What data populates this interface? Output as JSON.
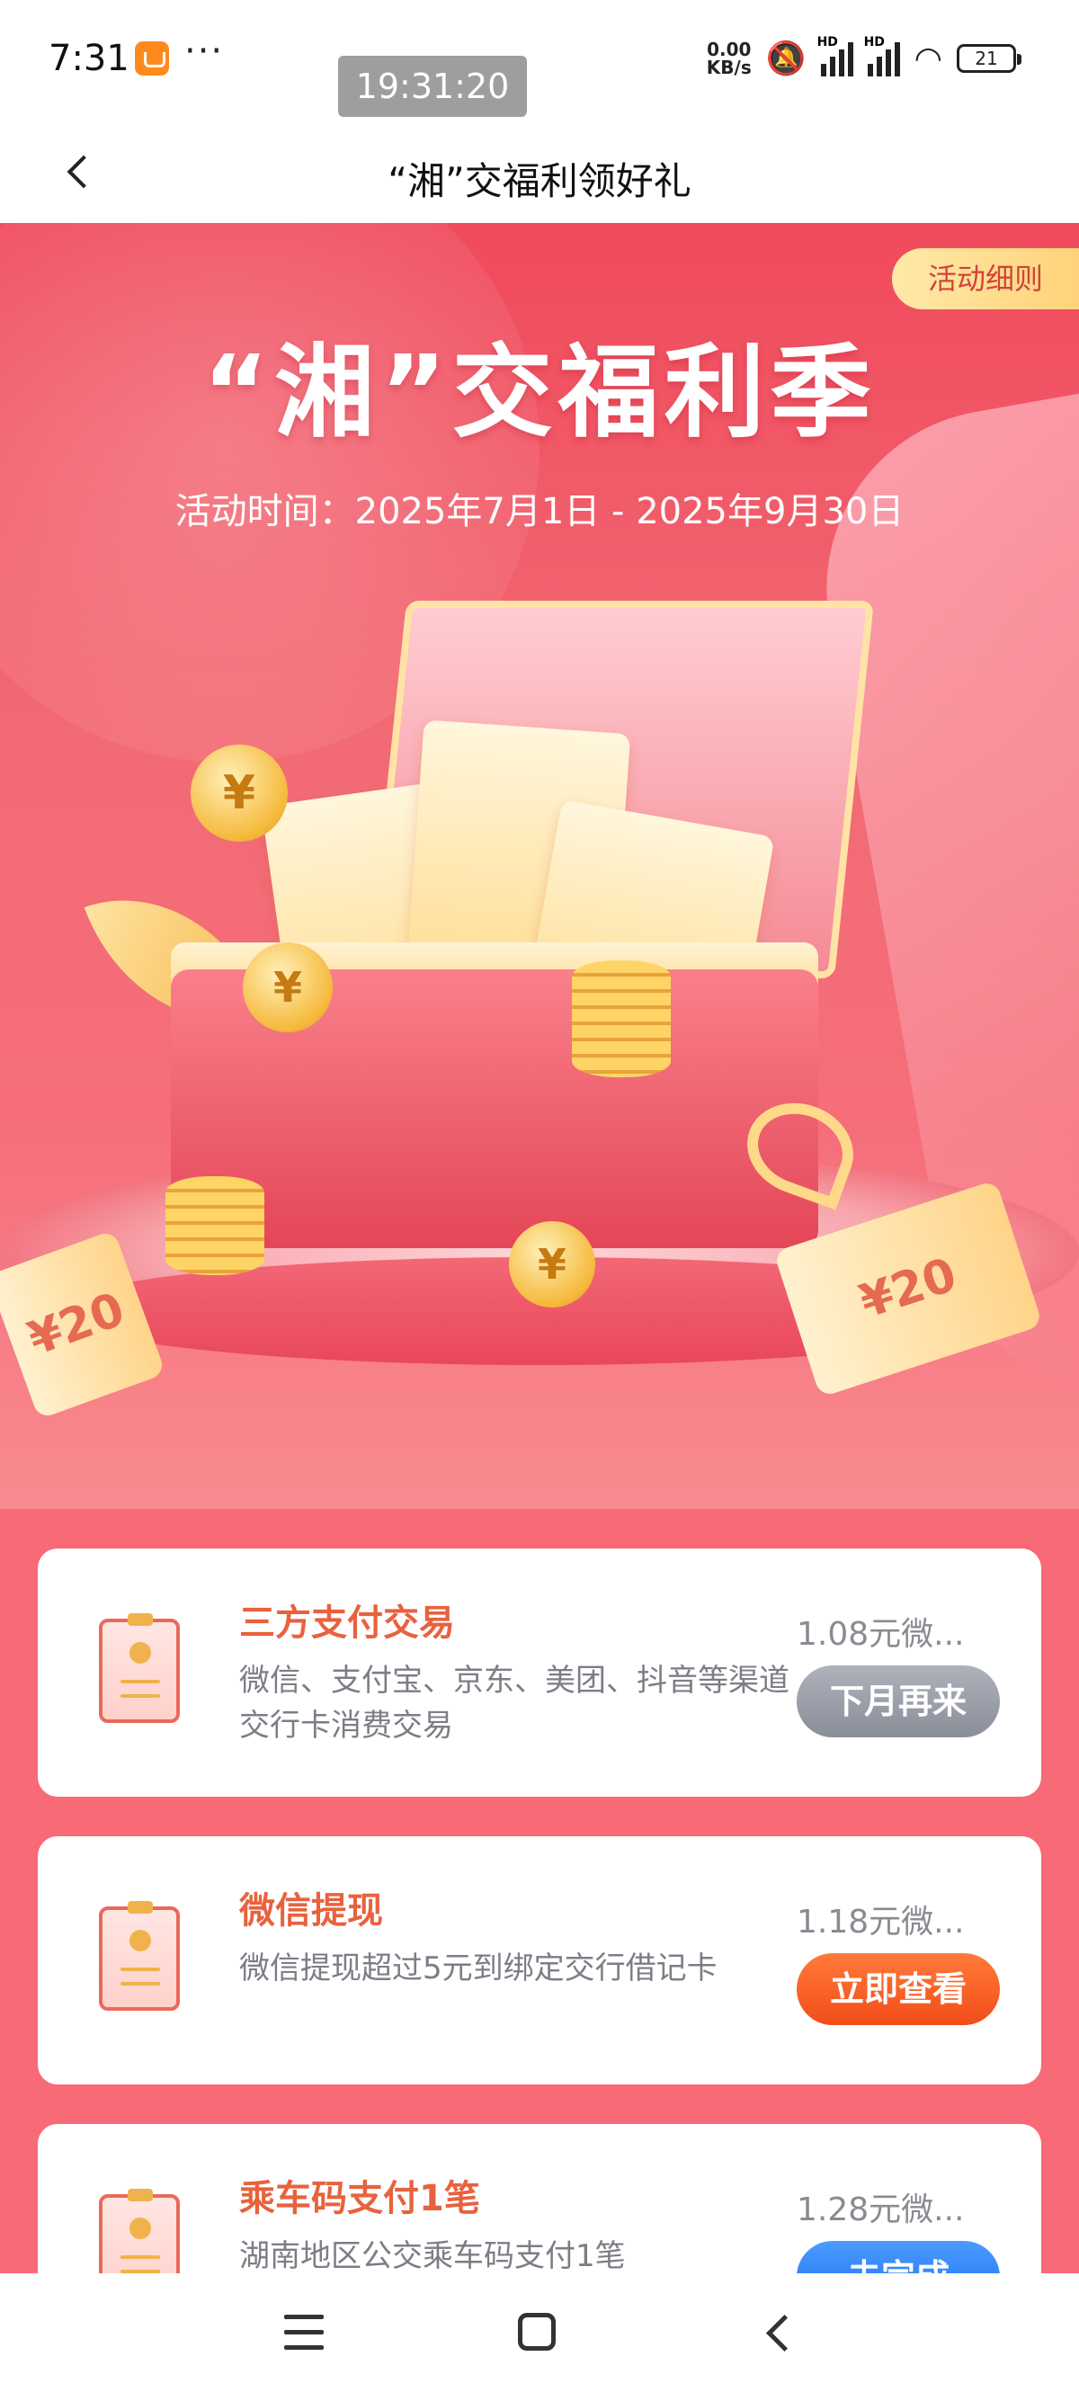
{
  "status_bar": {
    "time": "7:31",
    "more": "···",
    "clock_overlay": "19:31:20",
    "net_speed_value": "0.00",
    "net_speed_unit": "KB/s",
    "signal_label": "HD",
    "battery": "21"
  },
  "nav": {
    "title": "“湘”交福利领好礼"
  },
  "hero": {
    "rules_label": "活动细则",
    "title": "“湘”交福利季",
    "date_range": "活动时间：2025年7月1日 - 2025年9月30日",
    "note_value": "¥20",
    "coin_symbol": "¥"
  },
  "tasks": [
    {
      "title": "三方支付交易",
      "desc": "微信、支付宝、京东、美团、抖音等渠道交行卡消费交易",
      "reward": "1.08元微...",
      "button": "下月再来",
      "button_state": "disabled"
    },
    {
      "title": "微信提现",
      "desc": "微信提现超过5元到绑定交行借记卡",
      "reward": "1.18元微...",
      "button": "立即查看",
      "button_state": "active"
    },
    {
      "title": "乘车码支付1笔",
      "desc": "湖南地区公交乘车码支付1笔",
      "reward": "1.28元微...",
      "button": "未完成",
      "button_state": "pending"
    }
  ],
  "colors": {
    "hero_red": "#f04a5c",
    "title_orange": "#e8623e",
    "btn_gray": "#8a8e98",
    "btn_orange": "#f24d18",
    "btn_blue": "#1e6ef0"
  }
}
